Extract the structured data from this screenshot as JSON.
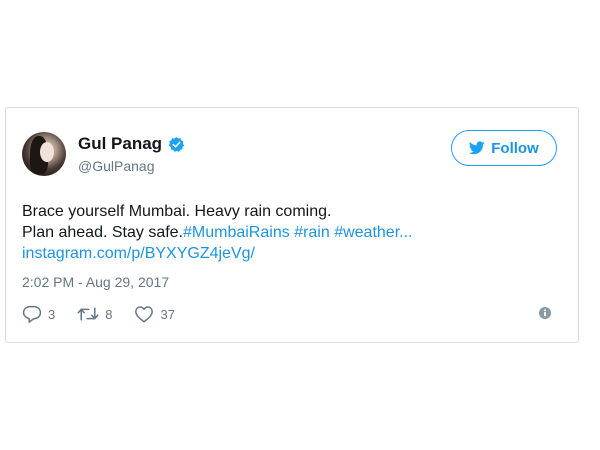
{
  "tweet": {
    "author": {
      "display_name": "Gul Panag",
      "handle": "@GulPanag",
      "verified": true
    },
    "follow_label": "Follow",
    "text_line1": "Brace yourself Mumbai. Heavy rain coming.",
    "text_line2_prefix": "Plan ahead. Stay safe.",
    "hashtags": [
      "#MumbaiRains",
      "#rain",
      "#weather..."
    ],
    "link": "instagram.com/p/BYXYGZ4jeVg/",
    "timestamp": "2:02 PM - Aug 29, 2017",
    "replies": "3",
    "retweets": "8",
    "likes": "37"
  },
  "colors": {
    "accent": "#1da1f2",
    "link": "#1b95e0",
    "muted": "#657786",
    "text": "#14171a"
  },
  "icons": [
    "verified-badge-icon",
    "twitter-bird-icon",
    "reply-icon",
    "retweet-icon",
    "like-icon",
    "info-icon"
  ]
}
